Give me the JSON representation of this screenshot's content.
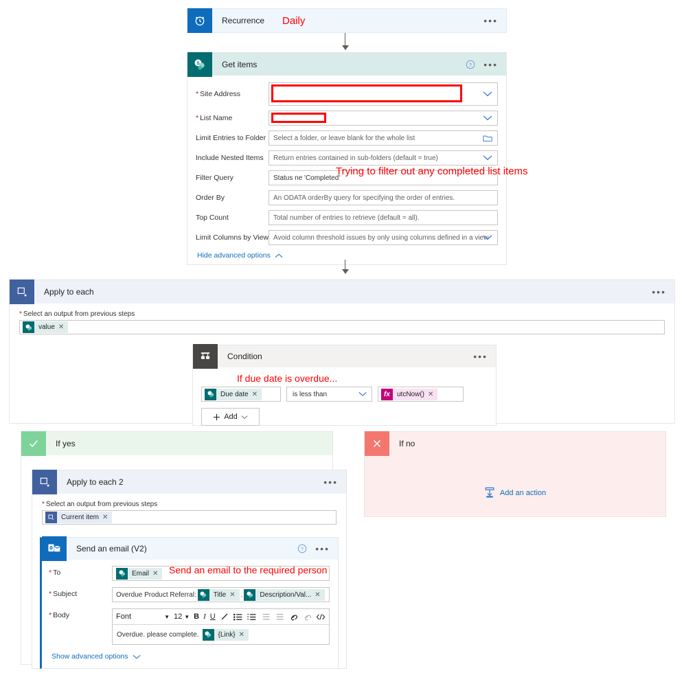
{
  "recurrence": {
    "title": "Recurrence",
    "annotation": "Daily",
    "icon": "clock-icon",
    "menu": "•••"
  },
  "get_items": {
    "title": "Get items",
    "icon": "sharepoint-icon",
    "help": "?",
    "menu": "•••",
    "fields": [
      {
        "label": "Site Address",
        "required": true,
        "value": "",
        "placeholder": "",
        "control": "dropdown",
        "redacted": true
      },
      {
        "label": "List Name",
        "required": true,
        "value": "",
        "placeholder": "",
        "control": "dropdown",
        "redacted": true
      },
      {
        "label": "Limit Entries to Folder",
        "required": false,
        "value": "",
        "placeholder": "Select a folder, or leave blank for the whole list",
        "control": "folder"
      },
      {
        "label": "Include Nested Items",
        "required": false,
        "value": "",
        "placeholder": "Return entries contained in sub-folders (default = true)",
        "control": "dropdown"
      },
      {
        "label": "Filter Query",
        "required": false,
        "value": "Status ne 'Completed'",
        "placeholder": "",
        "control": "text",
        "annotation": "Trying to filter out any completed list items"
      },
      {
        "label": "Order By",
        "required": false,
        "value": "",
        "placeholder": "An ODATA orderBy query for specifying the order of entries.",
        "control": "text"
      },
      {
        "label": "Top Count",
        "required": false,
        "value": "",
        "placeholder": "Total number of entries to retrieve (default = all).",
        "control": "text"
      },
      {
        "label": "Limit Columns by View",
        "required": false,
        "value": "",
        "placeholder": "Avoid column threshold issues by only using columns defined in a view",
        "control": "dropdown"
      }
    ],
    "advanced_link": "Hide advanced options"
  },
  "apply_to_each": {
    "title": "Apply to each",
    "icon": "foreach-icon",
    "menu": "•••",
    "output_label": "Select an output from previous steps",
    "token": {
      "label": "value",
      "icon": "sharepoint-icon",
      "remove": "✕"
    }
  },
  "condition": {
    "title": "Condition",
    "icon": "condition-icon",
    "menu": "•••",
    "annotation": "If due date is overdue...",
    "left": {
      "label": "Due date",
      "icon": "sharepoint-icon",
      "remove": "✕"
    },
    "operator": "is less than",
    "right": {
      "label": "utcNow()",
      "icon": "function-icon",
      "remove": "✕"
    },
    "add_label": "Add"
  },
  "if_yes": {
    "title": "If yes",
    "icon": "check-icon"
  },
  "if_no": {
    "title": "If no",
    "icon": "cross-icon",
    "add_action_label": "Add an action",
    "add_action_icon": "insert-step-icon"
  },
  "apply_to_each_2": {
    "title": "Apply to each 2",
    "icon": "foreach-icon",
    "menu": "•••",
    "output_label": "Select an output from previous steps",
    "token": {
      "label": "Current item",
      "icon": "foreach-icon",
      "remove": "✕"
    }
  },
  "send_email": {
    "title": "Send an email (V2)",
    "icon": "outlook-icon",
    "help": "?",
    "menu": "•••",
    "to": {
      "label": "To",
      "required": true,
      "token": {
        "label": "Email",
        "icon": "sharepoint-icon",
        "remove": "✕"
      },
      "annotation": "Send an email to the required person"
    },
    "subject": {
      "label": "Subject",
      "required": true,
      "text": "Overdue Product Referral:",
      "separator": ".",
      "token1": {
        "label": "Title",
        "icon": "sharepoint-icon",
        "remove": "✕"
      },
      "token2": {
        "label": "Description/Val...",
        "icon": "sharepoint-icon",
        "remove": "✕"
      }
    },
    "body": {
      "label": "Body",
      "required": true,
      "toolbar": {
        "font": "Font",
        "font_caret": "▼",
        "size": "12",
        "size_caret": "▼",
        "bold": "B",
        "italic": "I",
        "underline": "U",
        "highlight_icon": "pen-icon",
        "bullet_icon": "bullet-list-icon",
        "number_icon": "numbered-list-icon",
        "outdent_icon": "outdent-icon",
        "indent_icon": "indent-icon",
        "link_icon": "link-icon",
        "unlink_icon": "unlink-icon",
        "code_icon": "code-icon"
      },
      "text": "Overdue. please complete.",
      "token": {
        "label": "{Link}",
        "icon": "sharepoint-icon",
        "remove": "✕"
      }
    },
    "advanced_link": "Show advanced options"
  },
  "colors": {
    "accent_blue": "#0f6cbd",
    "sharepoint_teal": "#036c70",
    "annotation_red": "#ff0000",
    "loop_blue": "#41619e",
    "yes_green": "#7ed39b",
    "no_red": "#f4776f",
    "function_magenta": "#c4047c"
  }
}
